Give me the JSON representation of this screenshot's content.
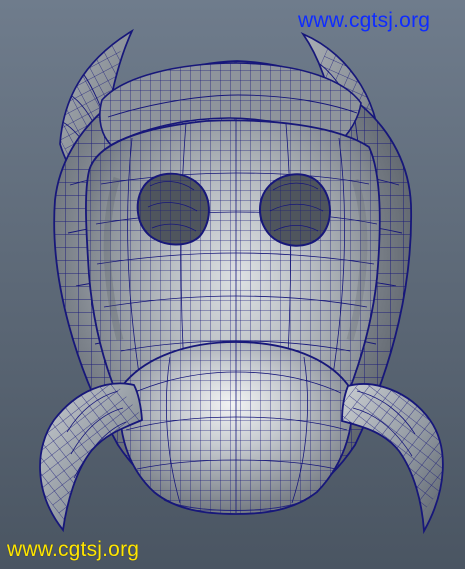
{
  "watermarks": {
    "top": "www.cgtsj.org",
    "bottom": "www.cgtsj.org"
  },
  "colors": {
    "viewport_top": "#6f7c8c",
    "viewport_bottom": "#47525f",
    "wire": "#17177a",
    "mesh_light": "#c7cbd0",
    "mesh_mid": "#8f959c",
    "mesh_dark": "#4f555d",
    "watermark_top": "#0f2cff",
    "watermark_bottom": "#ffe600"
  },
  "scene": {
    "subject": "cow-head-wireframe-model"
  }
}
